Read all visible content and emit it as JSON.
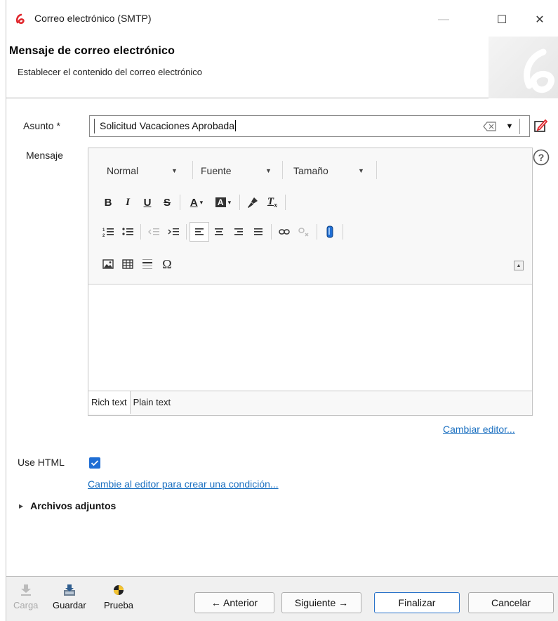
{
  "window": {
    "title": "Correo electrónico (SMTP)",
    "controls": {
      "minimize": "—",
      "maximize": "☐",
      "close": "✕"
    }
  },
  "header": {
    "title": "Mensaje de correo electrónico",
    "subtitle": "Establecer el contenido del correo electrónico"
  },
  "form": {
    "subject_label": "Asunto *",
    "subject_value": "Solicitud Vacaciones Aprobada",
    "message_label": "Mensaje",
    "use_html_label": "Use HTML",
    "use_html_checked": true,
    "change_editor_link": "Cambiar editor...",
    "condition_link": "Cambie al editor para crear una condición...",
    "attachments_label": "Archivos adjuntos"
  },
  "editor": {
    "format_combo": "Normal",
    "font_combo": "Fuente",
    "size_combo": "Tamaño",
    "row1": [
      "B",
      "I",
      "U",
      "S",
      "A",
      "A",
      "brush",
      "Tx"
    ],
    "tabs": [
      "Rich text",
      "Plain text"
    ],
    "active_tab": "Rich text"
  },
  "footer": {
    "load_label": "Carga",
    "save_label": "Guardar",
    "test_label": "Prueba",
    "prev_label": "← Anterior",
    "next_label": "Siguiente →",
    "finish_label": "Finalizar",
    "cancel_label": "Cancelar"
  },
  "colors": {
    "accent": "#1f6ed4",
    "link": "#1a6fc0",
    "brand_red": "#e0282e"
  }
}
